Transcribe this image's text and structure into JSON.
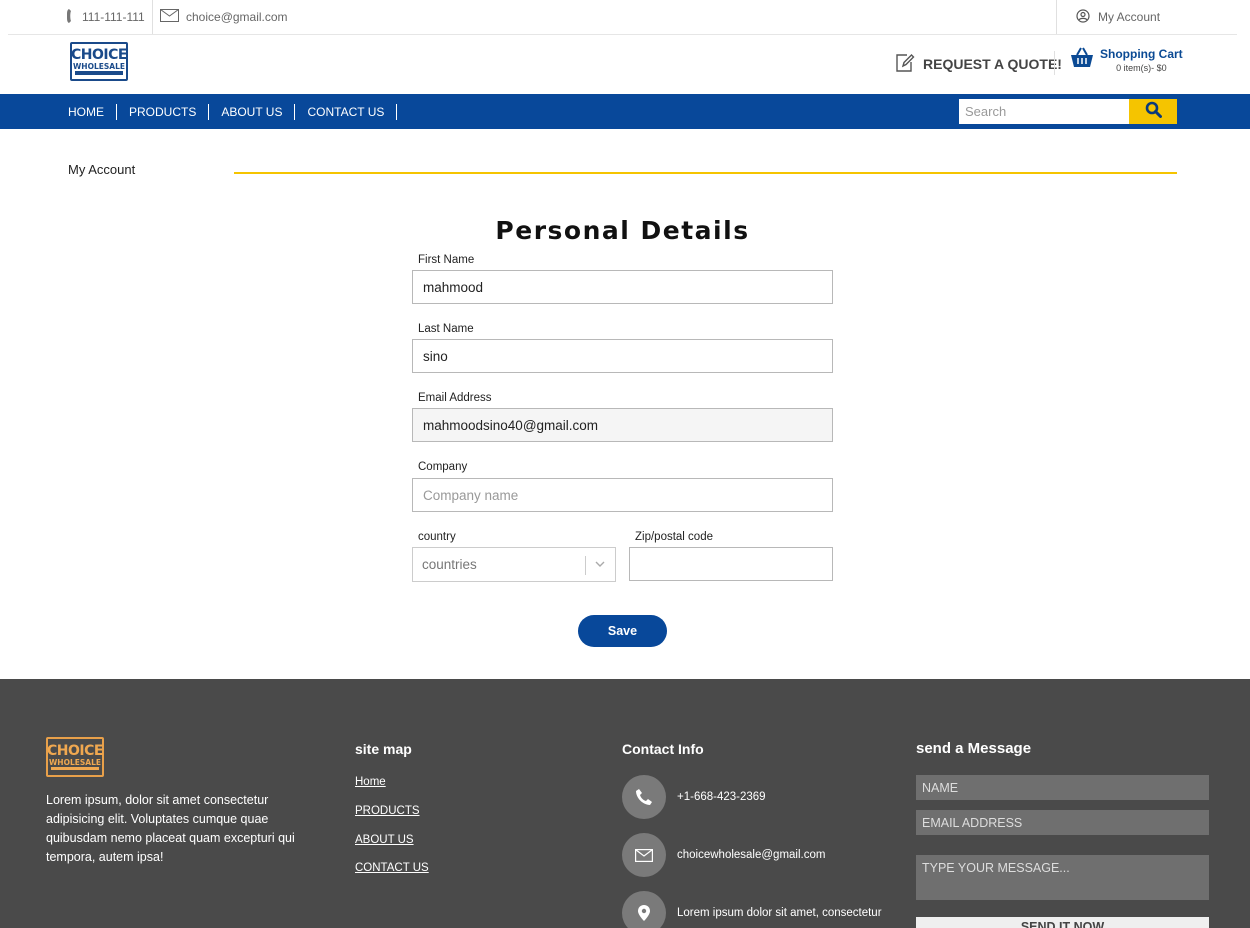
{
  "topbar": {
    "phone": "111-111-111",
    "email": "choice@gmail.com",
    "account": "My Account"
  },
  "header": {
    "logo_line1": "CHOICE",
    "logo_line2": "WHOLESALE",
    "quote_label": "REQUEST A QUOTE!",
    "cart_title": "Shopping Cart",
    "cart_summary": "0 item(s)- $0"
  },
  "nav": {
    "items": [
      "HOME",
      "PRODUCTS",
      "ABOUT US",
      "CONTACT US"
    ],
    "search_placeholder": "Search"
  },
  "page": {
    "breadcrumb": "My Account",
    "title": "Personal Details"
  },
  "form": {
    "first_name": {
      "label": "First Name",
      "value": "mahmood"
    },
    "last_name": {
      "label": "Last Name",
      "value": "sino"
    },
    "email": {
      "label": "Email Address",
      "value": "mahmoodsino40@gmail.com"
    },
    "company": {
      "label": "Company",
      "placeholder": "Company name"
    },
    "country": {
      "label": "country",
      "value": "countries"
    },
    "zip": {
      "label": "Zip/postal code",
      "value": ""
    },
    "save_label": "Save"
  },
  "footer": {
    "logo_line1": "CHOICE",
    "logo_line2": "WHOLESALE",
    "about": "Lorem ipsum, dolor sit amet consectetur adipisicing elit. Voluptates cumque quae quibusdam nemo placeat quam excepturi qui tempora, autem ipsa!",
    "sitemap_title": "site map",
    "sitemap": [
      "Home",
      "PRODUCTS",
      "ABOUT US",
      "CONTACT US"
    ],
    "contact_title": "Contact Info",
    "contact_phone": "+1-668-423-2369",
    "contact_email": "choicewholesale@gmail.com",
    "contact_address": "Lorem ipsum dolor sit amet, consectetur",
    "message_title": "send a Message",
    "name_placeholder": "NAME",
    "email_placeholder": "EMAIL ADDRESS",
    "message_placeholder": "TYPE YOUR MESSAGE...",
    "send_label": "SEND IT NOW"
  },
  "colors": {
    "brand_blue": "#08489a",
    "accent_yellow": "#f5c400",
    "footer_bg": "#4a4a4a"
  }
}
